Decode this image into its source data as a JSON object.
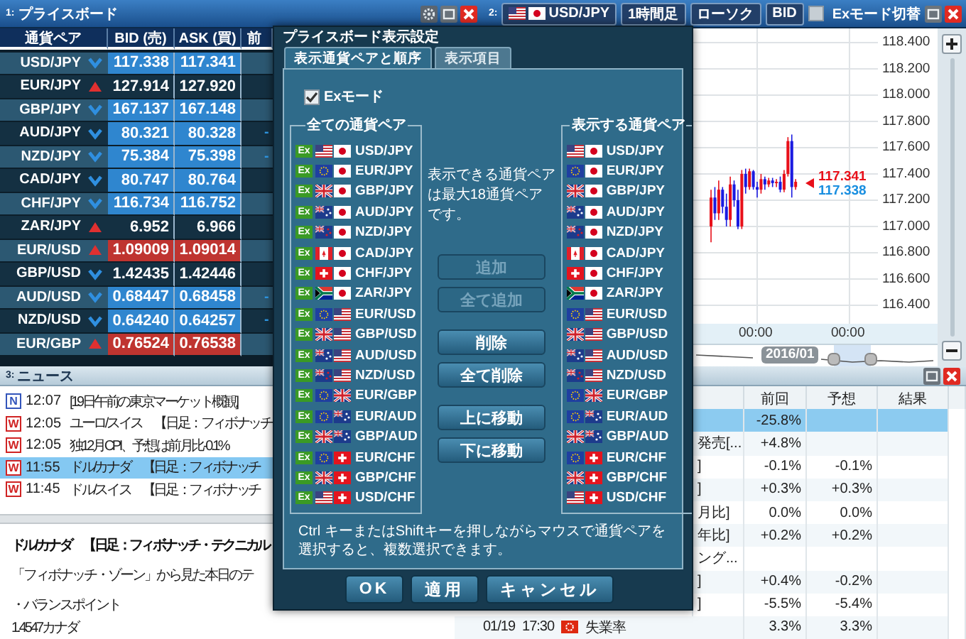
{
  "price_board": {
    "number": "1:",
    "title": "プライスボード",
    "columns": [
      "通貨ペア",
      "BID (売)",
      "ASK (買)",
      "前"
    ],
    "rows": [
      {
        "pair": "USD/JPY",
        "rising": false,
        "highlighted": true,
        "bid": "117.338",
        "ask": "117.341"
      },
      {
        "pair": "EUR/JPY",
        "rising": true,
        "highlighted": false,
        "bid": "127.914",
        "ask": "127.920"
      },
      {
        "pair": "GBP/JPY",
        "rising": false,
        "highlighted": true,
        "bid": "167.137",
        "ask": "167.148"
      },
      {
        "pair": "AUD/JPY",
        "rising": false,
        "highlighted": true,
        "bid": "80.321",
        "ask": "80.328",
        "column_4": "-"
      },
      {
        "pair": "NZD/JPY",
        "rising": false,
        "highlighted": true,
        "bid": "75.384",
        "ask": "75.398",
        "column_4": "-"
      },
      {
        "pair": "CAD/JPY",
        "rising": false,
        "highlighted": true,
        "bid": "80.747",
        "ask": "80.764"
      },
      {
        "pair": "CHF/JPY",
        "rising": false,
        "highlighted": true,
        "bid": "116.734",
        "ask": "116.752"
      },
      {
        "pair": "ZAR/JPY",
        "rising": true,
        "highlighted": false,
        "bid": "6.952",
        "ask": "6.966"
      },
      {
        "pair": "EUR/USD",
        "rising": true,
        "highlighted": true,
        "bid": "1.09009",
        "ask": "1.09014"
      },
      {
        "pair": "GBP/USD",
        "rising": false,
        "highlighted": false,
        "bid": "1.42435",
        "ask": "1.42446"
      },
      {
        "pair": "AUD/USD",
        "rising": false,
        "highlighted": true,
        "bid": "0.68447",
        "ask": "0.68458",
        "column_4": "-"
      },
      {
        "pair": "NZD/USD",
        "rising": false,
        "highlighted": true,
        "bid": "0.64240",
        "ask": "0.64257",
        "column_4": "-"
      },
      {
        "pair": "EUR/GBP",
        "rising": true,
        "highlighted": true,
        "bid": "0.76524",
        "ask": "0.76538"
      }
    ]
  },
  "chart": {
    "number": "2:",
    "pair": "USD/JPY",
    "pair_flags": [
      {
        "kind": "us"
      },
      {
        "kind": "jp"
      }
    ],
    "timeframe": "1時間足",
    "chart_type": "ローソク",
    "price_type": "BID",
    "ex_mode": {
      "label": "Exモード切替",
      "checked": false
    },
    "chart_data": {
      "type": "candlestick",
      "x": [
        -12,
        -11,
        -10,
        -9,
        -8,
        -7,
        -6,
        -5,
        -4,
        -3,
        -2,
        -1,
        0,
        1,
        2,
        3,
        4,
        5,
        6,
        7,
        8,
        9,
        10
      ],
      "ohlc": [
        [
          117.0,
          117.28,
          116.88,
          117.22
        ],
        [
          117.22,
          117.3,
          117.05,
          117.1
        ],
        [
          117.1,
          117.35,
          117.05,
          117.28
        ],
        [
          117.28,
          117.3,
          117.1,
          117.15
        ],
        [
          117.15,
          117.25,
          117.0,
          117.05
        ],
        [
          117.05,
          117.38,
          117.0,
          117.32
        ],
        [
          117.32,
          117.35,
          117.15,
          117.2
        ],
        [
          117.2,
          117.28,
          116.98,
          117.0
        ],
        [
          117.0,
          117.43,
          116.98,
          117.4
        ],
        [
          117.4,
          117.44,
          117.25,
          117.3
        ],
        [
          117.3,
          117.44,
          117.28,
          117.42
        ],
        [
          117.42,
          117.43,
          117.28,
          117.3
        ],
        [
          117.3,
          117.34,
          117.22,
          117.28
        ],
        [
          117.28,
          117.4,
          117.25,
          117.36
        ],
        [
          117.36,
          117.38,
          117.28,
          117.32
        ],
        [
          117.32,
          117.37,
          117.3,
          117.35
        ],
        [
          117.35,
          117.37,
          117.3,
          117.33
        ],
        [
          117.33,
          117.36,
          117.3,
          117.34
        ],
        [
          117.34,
          117.38,
          117.26,
          117.28
        ],
        [
          117.28,
          117.43,
          117.26,
          117.4
        ],
        [
          117.4,
          117.68,
          117.38,
          117.65
        ],
        [
          117.65,
          117.7,
          117.22,
          117.3
        ],
        [
          117.3,
          117.36,
          117.28,
          117.34
        ]
      ],
      "grid": true,
      "xlim": [
        -71.3,
        31.4
      ],
      "ylim": [
        116.259,
        118.508
      ],
      "yticks": [
        {
          "value": 118.4,
          "label": "118.400"
        },
        {
          "value": 118.2,
          "label": "118.200"
        },
        {
          "value": 118.0,
          "label": "118.000"
        },
        {
          "value": 117.8,
          "label": "117.800"
        },
        {
          "value": 117.6,
          "label": "117.600"
        },
        {
          "value": 117.4,
          "label": "117.400"
        },
        {
          "value": 117.2,
          "label": "117.200"
        },
        {
          "value": 117.0,
          "label": "117.000"
        },
        {
          "value": 116.8,
          "label": "116.800"
        },
        {
          "value": 116.6,
          "label": "116.600"
        },
        {
          "value": 116.4,
          "label": "116.400"
        }
      ],
      "xticks": [
        {
          "value": 0,
          "label": "00:00"
        },
        {
          "value": 24,
          "label": "00:00"
        }
      ]
    },
    "ask": "117.341",
    "bid": "117.338",
    "navigator_label": "2016/01"
  },
  "news": {
    "number": "3:",
    "title": "ニュース",
    "items": [
      {
        "source": "N",
        "color": "#3355bb",
        "time": "12:07",
        "headline": "[19日午前の東京マーケット概観]",
        "selected": false
      },
      {
        "source": "W",
        "color": "#d02424",
        "time": "12:05",
        "headline": "ユーロ/スイス　【日足：フィボナッチ",
        "selected": false
      },
      {
        "source": "W",
        "color": "#d02424",
        "time": "12:05",
        "headline": "独12月CPI、予想は前月比-0.1%",
        "selected": false
      },
      {
        "source": "W",
        "color": "#d02424",
        "time": "11:55",
        "headline": "ドル/カナダ　【日足：フィボナッチ",
        "selected": true
      },
      {
        "source": "W",
        "color": "#d02424",
        "time": "11:45",
        "headline": "ドル/スイス　【日足：フィボナッチ",
        "selected": false
      }
    ],
    "article": {
      "headline": "ドル/カナダ　【日足：フィボナッチ・テクニカル",
      "paragraphs": [
        "「フィボナッチ・ゾーン」から見た本日のテ",
        "・バランスポイント",
        "1.4547カナダ"
      ]
    }
  },
  "calendar": {
    "columns": [
      "前回",
      "予想",
      "結果"
    ],
    "rows": [
      {
        "kind": "partial",
        "previous": "-25.8%",
        "selected": true
      },
      {
        "kind": "partial",
        "event": "発売[...",
        "previous": "+4.8%",
        "selected": false
      },
      {
        "kind": "partial",
        "event": "]",
        "previous": "-0.1%",
        "forecast": "-0.1%",
        "selected": false
      },
      {
        "kind": "partial",
        "event": "]",
        "previous": "+0.3%",
        "forecast": "+0.3%",
        "selected": false
      },
      {
        "kind": "partial",
        "event": "月比]",
        "previous": "0.0%",
        "forecast": "0.0%",
        "selected": false
      },
      {
        "kind": "partial",
        "event": "年比]",
        "previous": "+0.2%",
        "forecast": "+0.2%",
        "selected": false
      },
      {
        "kind": "partial",
        "event": "ング...",
        "selected": false
      },
      {
        "kind": "partial",
        "event": "]",
        "previous": "+0.4%",
        "forecast": "-0.2%",
        "selected": false
      },
      {
        "kind": "partial",
        "event": "]",
        "previous": "-5.5%",
        "forecast": "-5.4%",
        "selected": false
      },
      {
        "kind": "full",
        "date": "01/19",
        "time": "17:30",
        "flag": {
          "kind": "hk"
        },
        "event": "失業率",
        "previous": "3.3%",
        "forecast": "3.3%",
        "selected": false
      }
    ]
  },
  "dialog": {
    "title": "プライスボード表示設定",
    "tabs": [
      {
        "label": "表示通貨ペアと順序",
        "selected": true
      },
      {
        "label": "表示項目",
        "selected": false
      }
    ],
    "ex_mode": {
      "label": "Exモード",
      "checked": true
    },
    "all_pairs": {
      "title": "全ての通貨ペア",
      "items": [
        {
          "badge": "Ex",
          "flags": [
            {
              "kind": "us"
            },
            {
              "kind": "jp"
            }
          ],
          "pair": "USD/JPY"
        },
        {
          "badge": "Ex",
          "flags": [
            {
              "kind": "eu"
            },
            {
              "kind": "jp"
            }
          ],
          "pair": "EUR/JPY"
        },
        {
          "badge": "Ex",
          "flags": [
            {
              "kind": "gb"
            },
            {
              "kind": "jp"
            }
          ],
          "pair": "GBP/JPY"
        },
        {
          "badge": "Ex",
          "flags": [
            {
              "kind": "au"
            },
            {
              "kind": "jp"
            }
          ],
          "pair": "AUD/JPY"
        },
        {
          "badge": "Ex",
          "flags": [
            {
              "kind": "nz"
            },
            {
              "kind": "jp"
            }
          ],
          "pair": "NZD/JPY"
        },
        {
          "badge": "Ex",
          "flags": [
            {
              "kind": "ca"
            },
            {
              "kind": "jp"
            }
          ],
          "pair": "CAD/JPY"
        },
        {
          "badge": "Ex",
          "flags": [
            {
              "kind": "ch"
            },
            {
              "kind": "jp"
            }
          ],
          "pair": "CHF/JPY"
        },
        {
          "badge": "Ex",
          "flags": [
            {
              "kind": "za"
            },
            {
              "kind": "jp"
            }
          ],
          "pair": "ZAR/JPY"
        },
        {
          "badge": "Ex",
          "flags": [
            {
              "kind": "eu"
            },
            {
              "kind": "us"
            }
          ],
          "pair": "EUR/USD"
        },
        {
          "badge": "Ex",
          "flags": [
            {
              "kind": "gb"
            },
            {
              "kind": "us"
            }
          ],
          "pair": "GBP/USD"
        },
        {
          "badge": "Ex",
          "flags": [
            {
              "kind": "au"
            },
            {
              "kind": "us"
            }
          ],
          "pair": "AUD/USD"
        },
        {
          "badge": "Ex",
          "flags": [
            {
              "kind": "nz"
            },
            {
              "kind": "us"
            }
          ],
          "pair": "NZD/USD"
        },
        {
          "badge": "Ex",
          "flags": [
            {
              "kind": "eu"
            },
            {
              "kind": "gb"
            }
          ],
          "pair": "EUR/GBP"
        },
        {
          "badge": "Ex",
          "flags": [
            {
              "kind": "eu"
            },
            {
              "kind": "au"
            }
          ],
          "pair": "EUR/AUD"
        },
        {
          "badge": "Ex",
          "flags": [
            {
              "kind": "gb"
            },
            {
              "kind": "au"
            }
          ],
          "pair": "GBP/AUD"
        },
        {
          "badge": "Ex",
          "flags": [
            {
              "kind": "eu"
            },
            {
              "kind": "ch"
            }
          ],
          "pair": "EUR/CHF"
        },
        {
          "badge": "Ex",
          "flags": [
            {
              "kind": "gb"
            },
            {
              "kind": "ch"
            }
          ],
          "pair": "GBP/CHF"
        },
        {
          "badge": "Ex",
          "flags": [
            {
              "kind": "us"
            },
            {
              "kind": "ch"
            }
          ],
          "pair": "USD/CHF"
        }
      ]
    },
    "note": "表示できる通貨ペアは最大18通貨ペアです。",
    "action_groups": [
      [
        {
          "label": "追加",
          "disabled": true
        },
        {
          "label": "全て追加",
          "disabled": true
        }
      ],
      [
        {
          "label": "削除",
          "disabled": false
        },
        {
          "label": "全て削除",
          "disabled": false
        }
      ],
      [
        {
          "label": "上に移動",
          "disabled": false
        },
        {
          "label": "下に移動",
          "disabled": false
        }
      ]
    ],
    "shown_pairs": {
      "title": "表示する通貨ペア",
      "items": [
        {
          "flags": [
            {
              "kind": "us"
            },
            {
              "kind": "jp"
            }
          ],
          "pair": "USD/JPY"
        },
        {
          "flags": [
            {
              "kind": "eu"
            },
            {
              "kind": "jp"
            }
          ],
          "pair": "EUR/JPY"
        },
        {
          "flags": [
            {
              "kind": "gb"
            },
            {
              "kind": "jp"
            }
          ],
          "pair": "GBP/JPY"
        },
        {
          "flags": [
            {
              "kind": "au"
            },
            {
              "kind": "jp"
            }
          ],
          "pair": "AUD/JPY"
        },
        {
          "flags": [
            {
              "kind": "nz"
            },
            {
              "kind": "jp"
            }
          ],
          "pair": "NZD/JPY"
        },
        {
          "flags": [
            {
              "kind": "ca"
            },
            {
              "kind": "jp"
            }
          ],
          "pair": "CAD/JPY"
        },
        {
          "flags": [
            {
              "kind": "ch"
            },
            {
              "kind": "jp"
            }
          ],
          "pair": "CHF/JPY"
        },
        {
          "flags": [
            {
              "kind": "za"
            },
            {
              "kind": "jp"
            }
          ],
          "pair": "ZAR/JPY"
        },
        {
          "flags": [
            {
              "kind": "eu"
            },
            {
              "kind": "us"
            }
          ],
          "pair": "EUR/USD"
        },
        {
          "flags": [
            {
              "kind": "gb"
            },
            {
              "kind": "us"
            }
          ],
          "pair": "GBP/USD"
        },
        {
          "flags": [
            {
              "kind": "au"
            },
            {
              "kind": "us"
            }
          ],
          "pair": "AUD/USD"
        },
        {
          "flags": [
            {
              "kind": "nz"
            },
            {
              "kind": "us"
            }
          ],
          "pair": "NZD/USD"
        },
        {
          "flags": [
            {
              "kind": "eu"
            },
            {
              "kind": "gb"
            }
          ],
          "pair": "EUR/GBP"
        },
        {
          "flags": [
            {
              "kind": "eu"
            },
            {
              "kind": "au"
            }
          ],
          "pair": "EUR/AUD"
        },
        {
          "flags": [
            {
              "kind": "gb"
            },
            {
              "kind": "au"
            }
          ],
          "pair": "GBP/AUD"
        },
        {
          "flags": [
            {
              "kind": "eu"
            },
            {
              "kind": "ch"
            }
          ],
          "pair": "EUR/CHF"
        },
        {
          "flags": [
            {
              "kind": "gb"
            },
            {
              "kind": "ch"
            }
          ],
          "pair": "GBP/CHF"
        },
        {
          "flags": [
            {
              "kind": "us"
            },
            {
              "kind": "ch"
            }
          ],
          "pair": "USD/CHF"
        }
      ]
    },
    "hint": "Ctrl キーまたはShiftキーを押しながらマウスで通貨ペアを選択すると、複数選択できます。",
    "buttons": [
      "OK",
      "適用",
      "キャンセル"
    ]
  }
}
